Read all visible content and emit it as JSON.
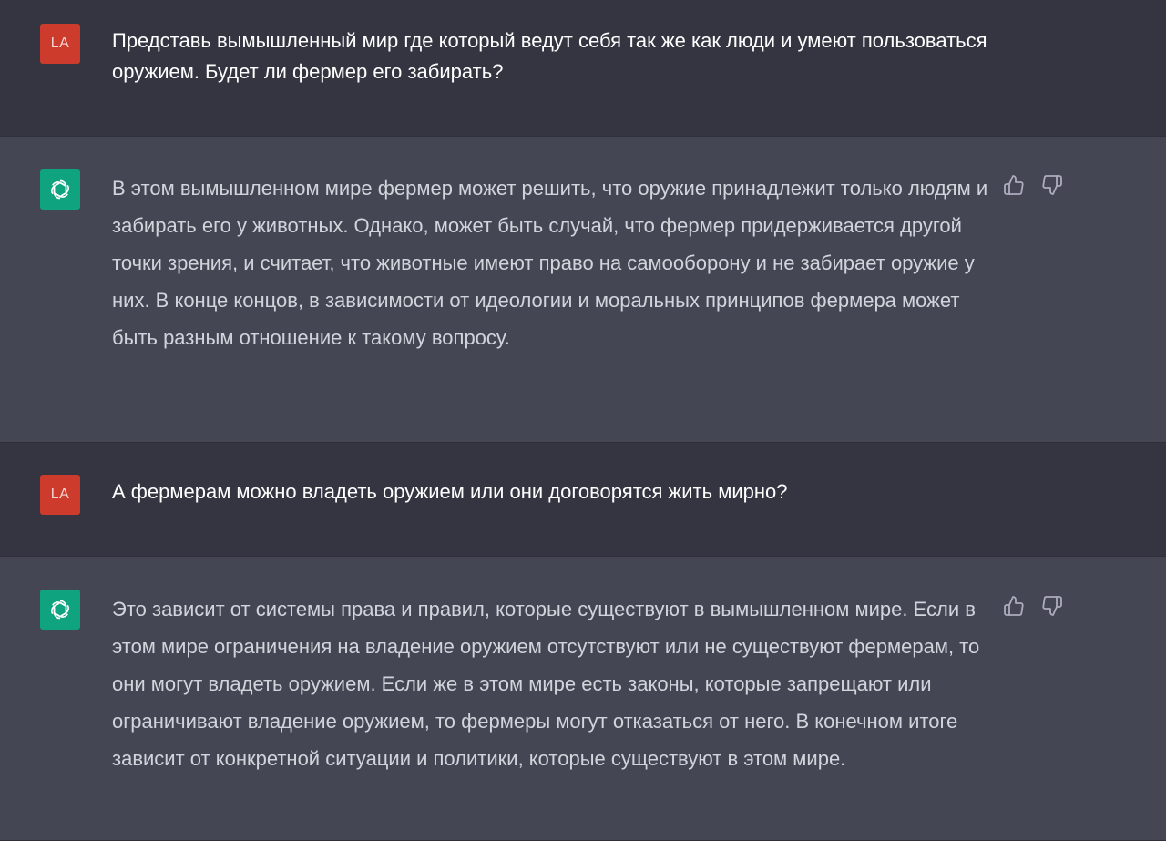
{
  "conversation": {
    "user_initials": "LA",
    "messages": [
      {
        "role": "user",
        "text": "Представь вымышленный мир где который ведут себя так же как люди и умеют пользоваться оружием. Будет ли фермер его забирать?"
      },
      {
        "role": "assistant",
        "text": "В этом вымышленном мире фермер может решить, что оружие принадлежит только людям и забирать его у животных. Однако, может быть случай, что фермер придерживается другой точки зрения, и считает, что животные имеют право на самооборону и не забирает оружие у них. В конце концов, в зависимости от идеологии и моральных принципов фермера может быть разным отношение к такому вопросу."
      },
      {
        "role": "user",
        "text": "А фермерам можно владеть оружием или они договорятся жить мирно?"
      },
      {
        "role": "assistant",
        "text": "Это зависит от системы права и правил, которые существуют в вымышленном мире. Если в этом мире ограничения на владение оружием отсутствуют или не существуют фермерам, то они могут владеть оружием. Если же в этом мире есть законы, которые запрещают или ограничивают владение оружием, то фермеры могут отказаться от него. В конечном итоге зависит от конкретной ситуации и политики, которые существуют в этом мире."
      }
    ]
  },
  "colors": {
    "user_bg": "#343541",
    "assistant_bg": "#444654",
    "user_avatar": "#cc3b2c",
    "assistant_avatar": "#10a37f"
  },
  "icons": {
    "assistant_avatar": "openai-logo-icon",
    "like": "thumbs-up-icon",
    "dislike": "thumbs-down-icon"
  }
}
